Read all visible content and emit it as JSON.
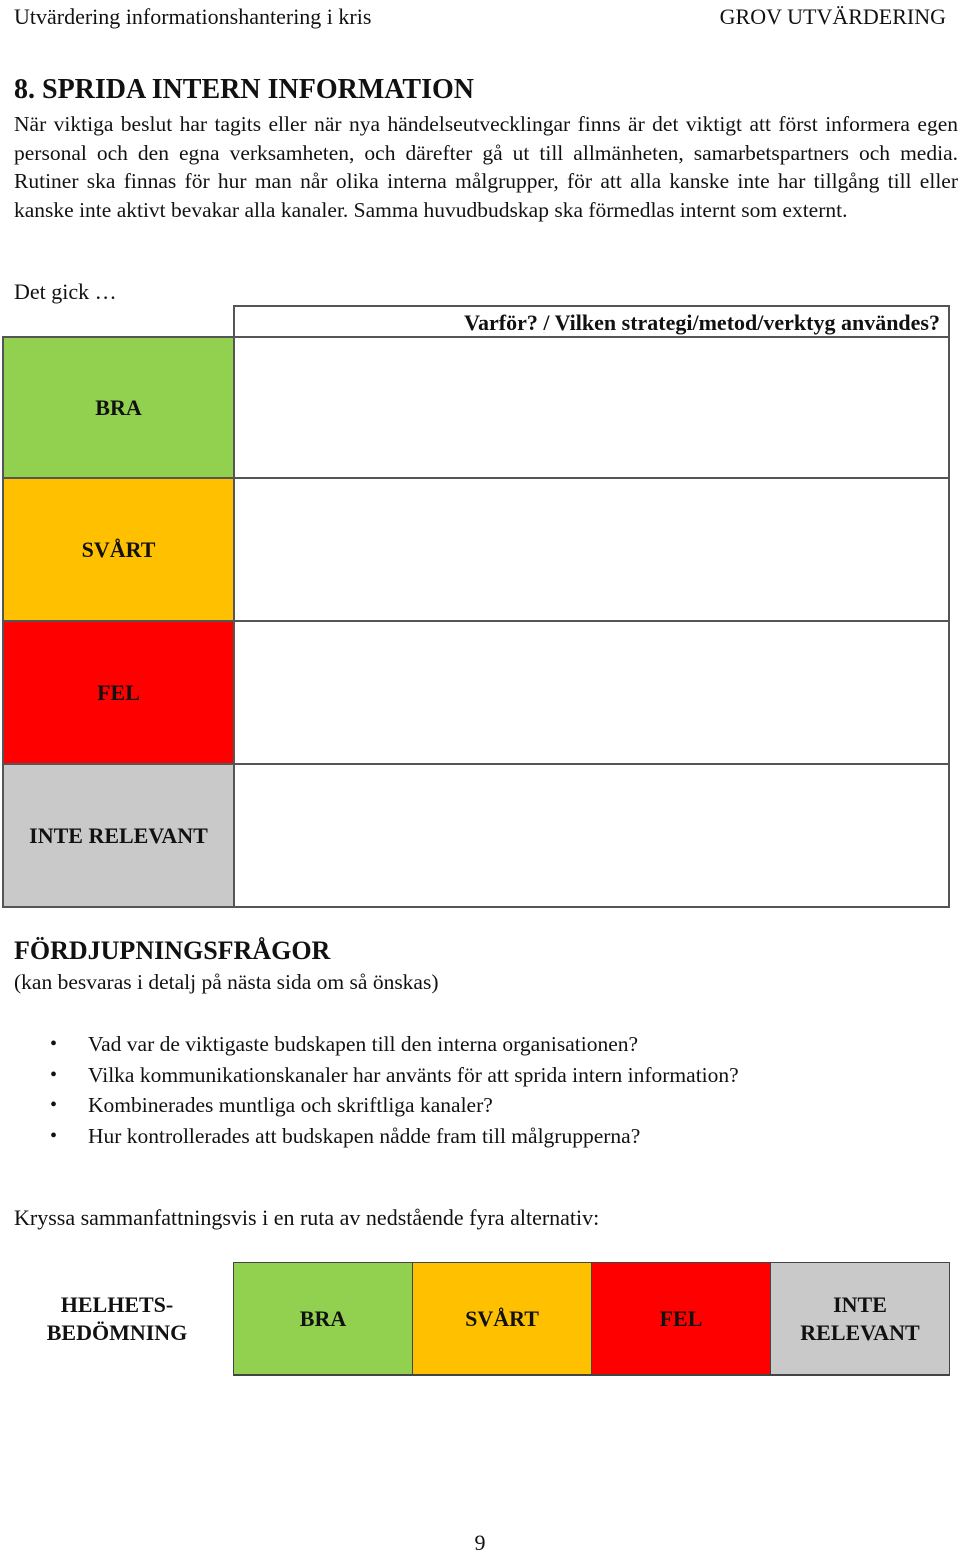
{
  "header": {
    "left": "Utvärdering informationshantering i kris",
    "right": "GROV UTVÄRDERING"
  },
  "section": {
    "title": "8. SPRIDA INTERN INFORMATION",
    "intro": "När viktiga beslut har tagits eller när nya händelseutvecklingar finns är det viktigt att först informera egen personal och den egna verksamheten, och därefter gå ut till allmänheten, samarbetspartners och media. Rutiner ska finnas för hur man når olika interna målgrupper, för att alla kanske inte har tillgång till eller kanske inte aktivt bevakar alla kanaler. Samma huvudbudskap ska förmedlas internt som externt."
  },
  "evaluation_table": {
    "lead": "Det gick …",
    "column_header": "Varför? / Vilken strategi/metod/verktyg användes?",
    "rows": [
      {
        "label": "BRA",
        "color": "#92d050",
        "answer": ""
      },
      {
        "label": "SVÅRT",
        "color": "#ffc000",
        "answer": ""
      },
      {
        "label": "FEL",
        "color": "#ff0000",
        "answer": ""
      },
      {
        "label": "INTE RELEVANT",
        "color": "#c9c9c9",
        "answer": ""
      }
    ]
  },
  "deepening": {
    "title": "FÖRDJUPNINGSFRÅGOR",
    "subtitle": "(kan besvaras i detalj på nästa sida om så önskas)",
    "bullet_icon": "•",
    "questions": [
      "Vad var de viktigaste budskapen till den interna organisationen?",
      "Vilka kommunikationskanaler har använts för att sprida intern information?",
      "Kombinerades muntliga och skriftliga kanaler?",
      "Hur kontrollerades att budskapen nådde fram till målgrupperna?"
    ]
  },
  "summary": {
    "instruction": "Kryssa sammanfattningsvis i en ruta av nedstående fyra alternativ:",
    "label_line1": "HELHETS-",
    "label_line2": "BEDÖMNING",
    "options": [
      {
        "line1": "BRA",
        "line2": "",
        "color": "#92d050"
      },
      {
        "line1": "SVÅRT",
        "line2": "",
        "color": "#ffc000"
      },
      {
        "line1": "FEL",
        "line2": "",
        "color": "#ff0000"
      },
      {
        "line1": "INTE",
        "line2": "RELEVANT",
        "color": "#c9c9c9"
      }
    ]
  },
  "page_number": "9"
}
